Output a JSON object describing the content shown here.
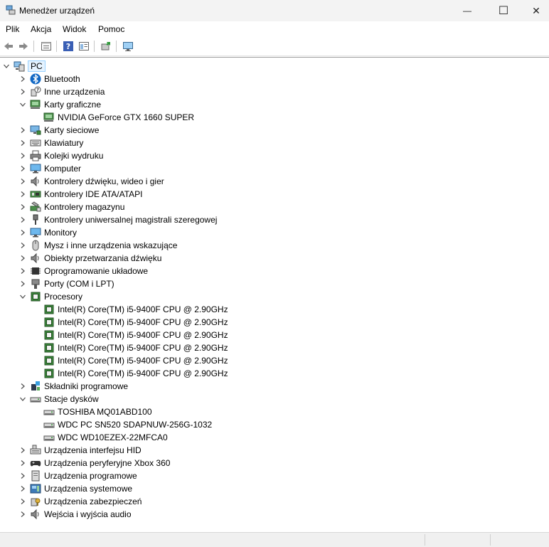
{
  "window": {
    "title": "Menedżer urządzeń",
    "minimize_glyph": "—",
    "maximize_glyph": "☐",
    "close_glyph": "✕"
  },
  "menu": [
    "Plik",
    "Akcja",
    "Widok",
    "Pomoc"
  ],
  "toolbar": [
    {
      "name": "back-arrow-icon"
    },
    {
      "name": "forward-arrow-icon"
    },
    {
      "name": "properties-icon"
    },
    {
      "name": "help-icon"
    },
    {
      "name": "view-icon"
    },
    {
      "name": "update-driver-icon"
    },
    {
      "name": "scan-hardware-icon"
    }
  ],
  "tree": [
    {
      "label": "PC",
      "level": 0,
      "state": "expanded",
      "icon": "computer-icon",
      "selected": true
    },
    {
      "label": "Bluetooth",
      "level": 1,
      "state": "collapsed",
      "icon": "bluetooth-icon"
    },
    {
      "label": "Inne urządzenia",
      "level": 1,
      "state": "collapsed",
      "icon": "unknown-device-icon"
    },
    {
      "label": "Karty graficzne",
      "level": 1,
      "state": "expanded",
      "icon": "display-adapter-icon"
    },
    {
      "label": "NVIDIA GeForce GTX 1660 SUPER",
      "level": 2,
      "state": "leaf",
      "icon": "display-adapter-icon"
    },
    {
      "label": "Karty sieciowe",
      "level": 1,
      "state": "collapsed",
      "icon": "network-adapter-icon"
    },
    {
      "label": "Klawiatury",
      "level": 1,
      "state": "collapsed",
      "icon": "keyboard-icon"
    },
    {
      "label": "Kolejki wydruku",
      "level": 1,
      "state": "collapsed",
      "icon": "printer-icon"
    },
    {
      "label": "Komputer",
      "level": 1,
      "state": "collapsed",
      "icon": "monitor-icon"
    },
    {
      "label": "Kontrolery dźwięku, wideo i gier",
      "level": 1,
      "state": "collapsed",
      "icon": "speaker-icon"
    },
    {
      "label": "Kontrolery IDE ATA/ATAPI",
      "level": 1,
      "state": "collapsed",
      "icon": "ide-controller-icon"
    },
    {
      "label": "Kontrolery magazynu",
      "level": 1,
      "state": "collapsed",
      "icon": "storage-controller-icon"
    },
    {
      "label": "Kontrolery uniwersalnej magistrali szeregowej",
      "level": 1,
      "state": "collapsed",
      "icon": "usb-icon"
    },
    {
      "label": "Monitory",
      "level": 1,
      "state": "collapsed",
      "icon": "monitor-icon"
    },
    {
      "label": "Mysz i inne urządzenia wskazujące",
      "level": 1,
      "state": "collapsed",
      "icon": "mouse-icon"
    },
    {
      "label": "Obiekty przetwarzania dźwięku",
      "level": 1,
      "state": "collapsed",
      "icon": "speaker-icon"
    },
    {
      "label": "Oprogramowanie układowe",
      "level": 1,
      "state": "collapsed",
      "icon": "firmware-chip-icon"
    },
    {
      "label": "Porty (COM i LPT)",
      "level": 1,
      "state": "collapsed",
      "icon": "port-icon"
    },
    {
      "label": "Procesory",
      "level": 1,
      "state": "expanded",
      "icon": "processor-icon"
    },
    {
      "label": "Intel(R) Core(TM) i5-9400F CPU @ 2.90GHz",
      "level": 2,
      "state": "leaf",
      "icon": "processor-icon"
    },
    {
      "label": "Intel(R) Core(TM) i5-9400F CPU @ 2.90GHz",
      "level": 2,
      "state": "leaf",
      "icon": "processor-icon"
    },
    {
      "label": "Intel(R) Core(TM) i5-9400F CPU @ 2.90GHz",
      "level": 2,
      "state": "leaf",
      "icon": "processor-icon"
    },
    {
      "label": "Intel(R) Core(TM) i5-9400F CPU @ 2.90GHz",
      "level": 2,
      "state": "leaf",
      "icon": "processor-icon"
    },
    {
      "label": "Intel(R) Core(TM) i5-9400F CPU @ 2.90GHz",
      "level": 2,
      "state": "leaf",
      "icon": "processor-icon"
    },
    {
      "label": "Intel(R) Core(TM) i5-9400F CPU @ 2.90GHz",
      "level": 2,
      "state": "leaf",
      "icon": "processor-icon"
    },
    {
      "label": "Składniki programowe",
      "level": 1,
      "state": "collapsed",
      "icon": "software-component-icon"
    },
    {
      "label": "Stacje dysków",
      "level": 1,
      "state": "expanded",
      "icon": "disk-drive-icon"
    },
    {
      "label": "TOSHIBA MQ01ABD100",
      "level": 2,
      "state": "leaf",
      "icon": "disk-drive-icon"
    },
    {
      "label": "WDC PC SN520 SDAPNUW-256G-1032",
      "level": 2,
      "state": "leaf",
      "icon": "disk-drive-icon"
    },
    {
      "label": "WDC WD10EZEX-22MFCA0",
      "level": 2,
      "state": "leaf",
      "icon": "disk-drive-icon"
    },
    {
      "label": "Urządzenia interfejsu HID",
      "level": 1,
      "state": "collapsed",
      "icon": "hid-icon"
    },
    {
      "label": "Urządzenia peryferyjne Xbox 360",
      "level": 1,
      "state": "collapsed",
      "icon": "gamepad-icon"
    },
    {
      "label": "Urządzenia programowe",
      "level": 1,
      "state": "collapsed",
      "icon": "software-device-icon"
    },
    {
      "label": "Urządzenia systemowe",
      "level": 1,
      "state": "collapsed",
      "icon": "system-device-icon"
    },
    {
      "label": "Urządzenia zabezpieczeń",
      "level": 1,
      "state": "collapsed",
      "icon": "security-device-icon"
    },
    {
      "label": "Wejścia i wyjścia audio",
      "level": 1,
      "state": "collapsed",
      "icon": "speaker-icon"
    }
  ]
}
